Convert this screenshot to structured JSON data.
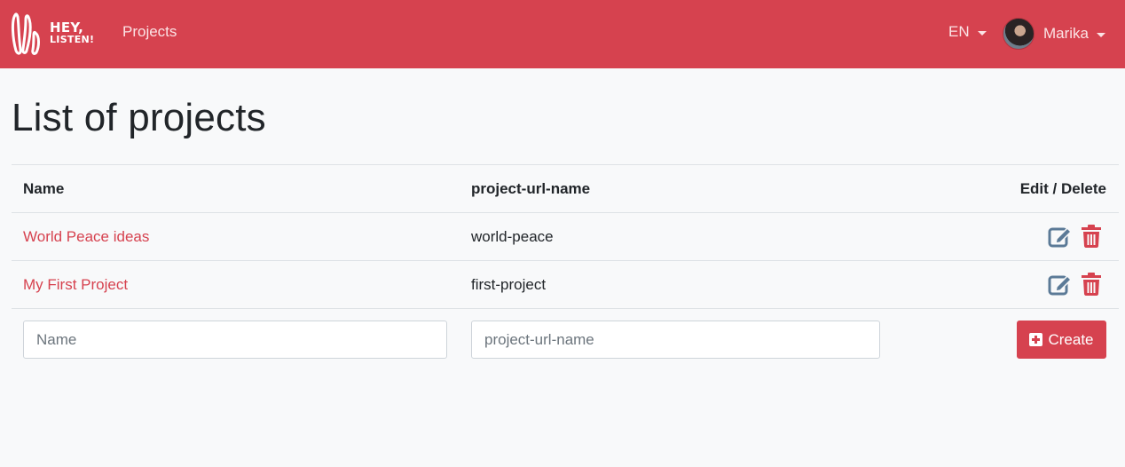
{
  "navbar": {
    "brand_line1": "HEY,",
    "brand_line2": "LISTEN!",
    "projects_link": "Projects",
    "language": "EN",
    "user_name": "Marika",
    "colors": {
      "background": "#d6424f",
      "text": "#fbe3e5"
    }
  },
  "page": {
    "title": "List of projects"
  },
  "table": {
    "headers": {
      "name": "Name",
      "url_name": "project-url-name",
      "actions": "Edit / Delete"
    },
    "rows": [
      {
        "name": "World Peace ideas",
        "url_name": "world-peace"
      },
      {
        "name": "My First Project",
        "url_name": "first-project"
      }
    ]
  },
  "form": {
    "name_placeholder": "Name",
    "name_value": "",
    "url_placeholder": "project-url-name",
    "url_value": "",
    "create_label": "Create"
  },
  "colors": {
    "accent": "#d6424f",
    "edit_icon": "#5b7a97",
    "delete_icon": "#d6424f"
  }
}
